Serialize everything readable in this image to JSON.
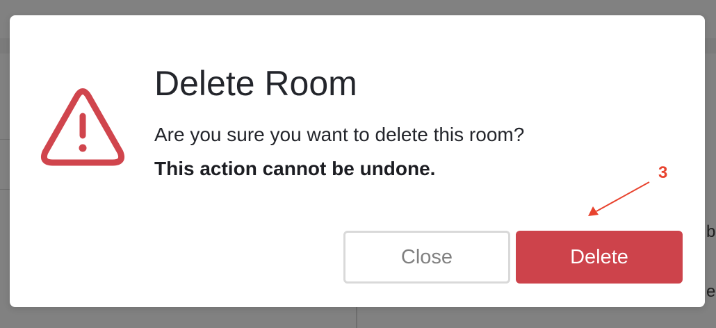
{
  "background": {
    "peek_text_1": "b",
    "peek_text_2": "e"
  },
  "modal": {
    "icon": "warning-triangle-icon",
    "title": "Delete Room",
    "message": "Are you sure you want to delete this room?",
    "warning": "This action cannot be undone.",
    "buttons": {
      "close_label": "Close",
      "delete_label": "Delete"
    }
  },
  "annotation": {
    "number": "3",
    "color": "#e8432e"
  },
  "colors": {
    "danger": "#cd434b",
    "overlay": "#818181",
    "text": "#23252b"
  }
}
